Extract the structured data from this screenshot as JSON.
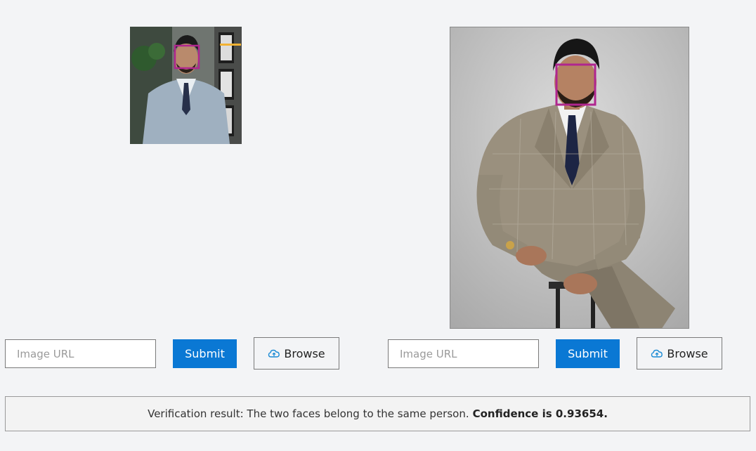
{
  "images": {
    "left": {
      "description_icon": "portrait-photo",
      "face_box_color": "#b0268f"
    },
    "right": {
      "description_icon": "portrait-photo",
      "face_box_color": "#b0268f"
    }
  },
  "form_left": {
    "url_placeholder": "Image URL",
    "submit_label": "Submit",
    "browse_label": "Browse",
    "browse_icon": "upload-cloud-icon"
  },
  "form_right": {
    "url_placeholder": "Image URL",
    "submit_label": "Submit",
    "browse_label": "Browse",
    "browse_icon": "upload-cloud-icon"
  },
  "result": {
    "message": "Verification result:  The two faces belong to the same person.",
    "confidence": "Confidence is 0.93654."
  },
  "colors": {
    "accent": "#0a78d4",
    "face_box": "#b0268f",
    "background": "#f3f4f6"
  }
}
